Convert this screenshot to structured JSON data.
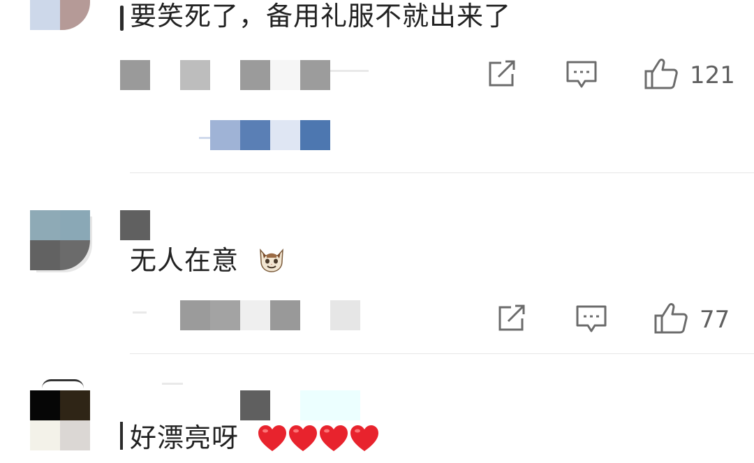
{
  "comments": [
    {
      "text": "要笑死了，备用礼服不就出来了",
      "likes": "121",
      "avatar_colors": [
        "#cdd8ea",
        "#b59a97"
      ],
      "redacted_username_colors": [],
      "redacted_meta_colors": [
        "#9a9a9a",
        "#bdbdbd",
        "#9b9b9b",
        "#f3f3f3",
        "#9c9c9c"
      ],
      "redacted_reply_colors": [
        "#9fb3d6",
        "#5a7fb5",
        "#d6def0",
        "#4d77b0"
      ]
    },
    {
      "text": "无人在意",
      "emoji": "cat-face-emoji",
      "likes": "77",
      "avatar_colors": [
        "#8eaab6",
        "#8aa8b6",
        "#626262",
        "#6b6b6b"
      ],
      "redacted_username_colors": [
        "#606060"
      ],
      "redacted_meta_colors": [
        "#9b9b9b",
        "#a3a3a3",
        "#efefef",
        "#999999",
        "#e6e6e6"
      ]
    },
    {
      "text": "好漂亮呀",
      "emoji": "heart-emoji",
      "heart_count": 4,
      "avatar_colors": [
        "#060606",
        "#2f2516",
        "#f3f2e9",
        "#dbd7d4"
      ],
      "redacted_username_colors": [
        "#5f5f5f",
        "#ecffff"
      ]
    }
  ],
  "colors": {
    "icon": "#6b6b6b",
    "divider": "#e6e6e6",
    "heart": "#e8232d",
    "text": "#222222"
  },
  "icons": {
    "share": "share-icon",
    "comment": "comment-icon",
    "like": "thumbs-up-icon"
  }
}
